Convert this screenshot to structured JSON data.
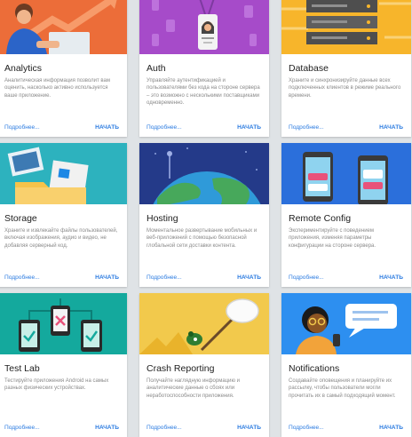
{
  "common": {
    "more_label": "Подробнее...",
    "start_label": "НАЧАТЬ"
  },
  "cards": [
    {
      "title": "Analytics",
      "description": "Аналитическая информация позволит вам оценить, насколько активно используется ваше приложение.",
      "art_color": "#ec6d39"
    },
    {
      "title": "Auth",
      "description": "Управляйте аутентификацией и пользователями без кода на стороне сервера – это возможно с несколькими поставщиками одновременно.",
      "art_color": "#a64bc9"
    },
    {
      "title": "Database",
      "description": "Храните и синхронизируйте данные всех подключенных клиентов в режиме реального времени.",
      "art_color": "#f7b52b"
    },
    {
      "title": "Storage",
      "description": "Храните и извлекайте файлы пользователей, включая изображения, аудио и видео, не добавляя серверный код.",
      "art_color": "#2db2be"
    },
    {
      "title": "Hosting",
      "description": "Моментальное развертывание мобильных и веб-приложений с помощью безопасной глобальной сети доставки контента.",
      "art_color": "#243a89"
    },
    {
      "title": "Remote Config",
      "description": "Экспериментируйте с поведением приложения, изменяя параметры конфигурации на стороне сервера.",
      "art_color": "#2b6fdb"
    },
    {
      "title": "Test Lab",
      "description": "Тестируйте приложения Android на самых разных физических устройствах.",
      "art_color": "#14a99d"
    },
    {
      "title": "Crash Reporting",
      "description": "Получайте наглядную информацию и аналитические данные о сбоях или неработоспособности приложения.",
      "art_color": "#f2c94c"
    },
    {
      "title": "Notifications",
      "description": "Создавайте оповещения и планируйте их рассылку, чтобы пользователи могли прочитать их в самый подходящий момент.",
      "art_color": "#2d8ff0"
    }
  ]
}
